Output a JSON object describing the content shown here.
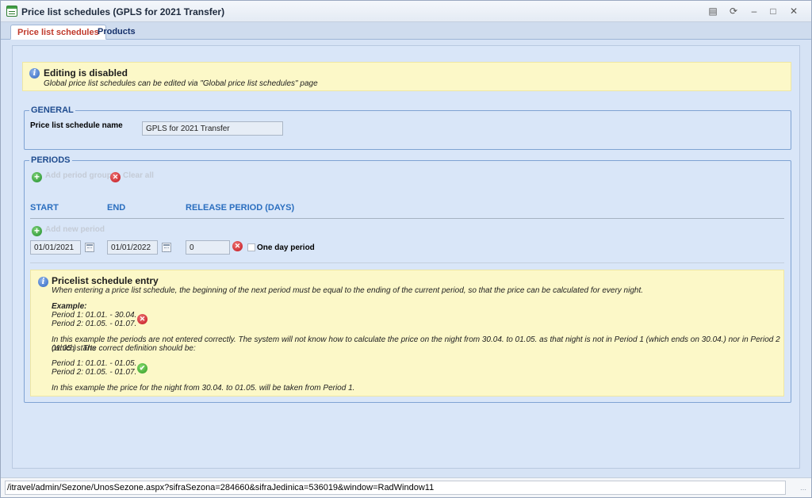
{
  "window": {
    "title": "Price list schedules (GPLS for 2021 Transfer)",
    "controls": [
      "pin-icon",
      "restore-icon",
      "minimize-icon",
      "maximize-icon",
      "close-icon"
    ]
  },
  "tabs": [
    {
      "label": "Price list schedules",
      "active": true
    },
    {
      "label": "Products",
      "active": false
    }
  ],
  "notice": {
    "title": "Editing is disabled",
    "subtitle": "Global price list schedules can be edited via \"Global price list schedules\" page"
  },
  "general": {
    "legend": "GENERAL",
    "name_label": "Price list schedule name",
    "name_value": "GPLS for 2021 Transfer"
  },
  "periods": {
    "legend": "PERIODS",
    "add_group": "Add period group",
    "clear_all": "Clear all",
    "col_start": "START",
    "col_end": "END",
    "col_release": "RELEASE PERIOD (DAYS)",
    "add_new_period": "Add new period",
    "row": {
      "start": "01/01/2021",
      "end": "01/01/2022",
      "release": "0",
      "one_day_label": "One day period",
      "one_day_checked": false
    }
  },
  "entry_help": {
    "title": "Pricelist schedule entry",
    "intro": "When entering a price list schedule, the beginning of the next period must be equal to the ending of the current period, so that the price can be calculated for every night.",
    "example_label": "Example:",
    "bad_p1": "Period 1: 01.01. - 30.04.",
    "bad_p2": "Period 2: 01.05. - 01.07.",
    "explain_1": "In this example the periods are not entered correctly. The system will not know how to calculate the price on the night from 30.04. to 01.05. as that night is not in Period 1 (which ends on 30.04.) nor in Period 2 (which starts",
    "explain_2": "01.05.) . The correct definition should be:",
    "good_p1": "Period 1: 01.01. - 01.05.",
    "good_p2": "Period 2: 01.05. - 01.07.",
    "conclusion": "In this example the price for the night from 30.04. to 01.05. will be taken from Period 1."
  },
  "status_bar": {
    "url": "/itravel/admin/Sezone/UnosSezone.aspx?sifraSezona=284660&sifraJedinica=536019&window=RadWindow11"
  },
  "colors": {
    "accent_blue": "#2a6ebf",
    "active_tab_text": "#c0392b",
    "notice_bg": "#fcf8c8",
    "content_bg": "#d9e6f8"
  }
}
